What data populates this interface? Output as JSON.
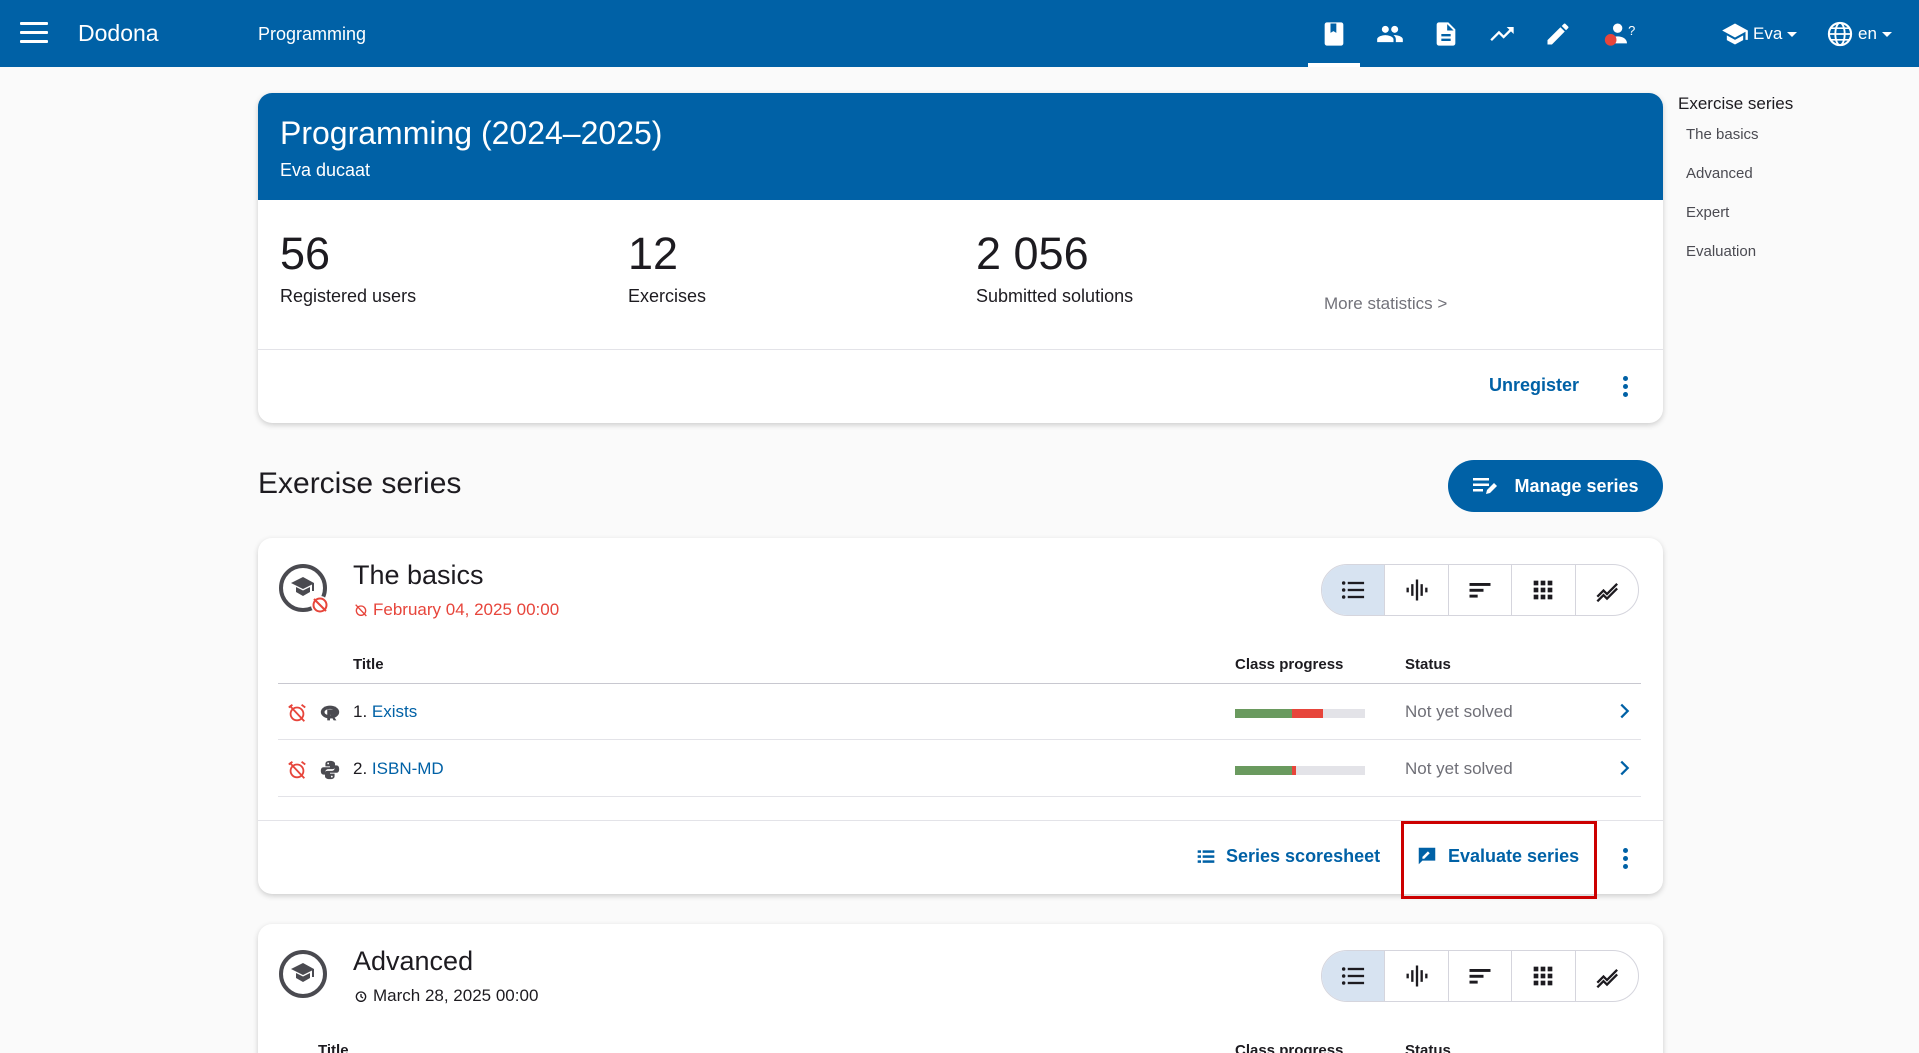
{
  "appbar": {
    "brand": "Dodona",
    "breadcrumb": "Programming",
    "user_name": "Eva",
    "language": "en",
    "nav_icons": [
      "course-book-icon",
      "users-icon",
      "document-icon",
      "trending-up-icon",
      "pencil-icon",
      "user-question-icon"
    ]
  },
  "course": {
    "title": "Programming (2024–2025)",
    "teacher": "Eva ducaat",
    "stats": [
      {
        "value": "56",
        "label": "Registered users"
      },
      {
        "value": "12",
        "label": "Exercises"
      },
      {
        "value": "2 056",
        "label": "Submitted solutions"
      }
    ],
    "more_stats": "More statistics >",
    "unregister": "Unregister"
  },
  "toc": {
    "title": "Exercise series",
    "items": [
      "The basics",
      "Advanced",
      "Expert",
      "Evaluation"
    ]
  },
  "series_section": {
    "title": "Exercise series",
    "manage_label": "Manage series"
  },
  "series": [
    {
      "name": "The basics",
      "deadline": "February 04, 2025 00:00",
      "deadline_color": "#e7453b",
      "headers": {
        "title": "Title",
        "progress": "Class progress",
        "status": "Status"
      },
      "exercises": [
        {
          "num": "1.",
          "name": "Exists",
          "language_icon": "r-language-icon",
          "progress_green": 0.44,
          "progress_red": 0.24,
          "status": "Not yet solved"
        },
        {
          "num": "2.",
          "name": "ISBN-MD",
          "language_icon": "python-icon",
          "progress_green": 0.44,
          "progress_red": 0.03,
          "status": "Not yet solved"
        }
      ],
      "scoresheet_label": "Series scoresheet",
      "evaluate_label": "Evaluate series"
    },
    {
      "name": "Advanced",
      "deadline": "March 28, 2025 00:00",
      "deadline_color": "#1d1b20",
      "headers": {
        "title": "Title",
        "progress": "Class progress",
        "status": "Status"
      }
    }
  ],
  "colors": {
    "primary": "#0061a6",
    "highlight": "#cc0000",
    "progress_good": "#6a9a5f",
    "progress_bad": "#e7453b"
  }
}
